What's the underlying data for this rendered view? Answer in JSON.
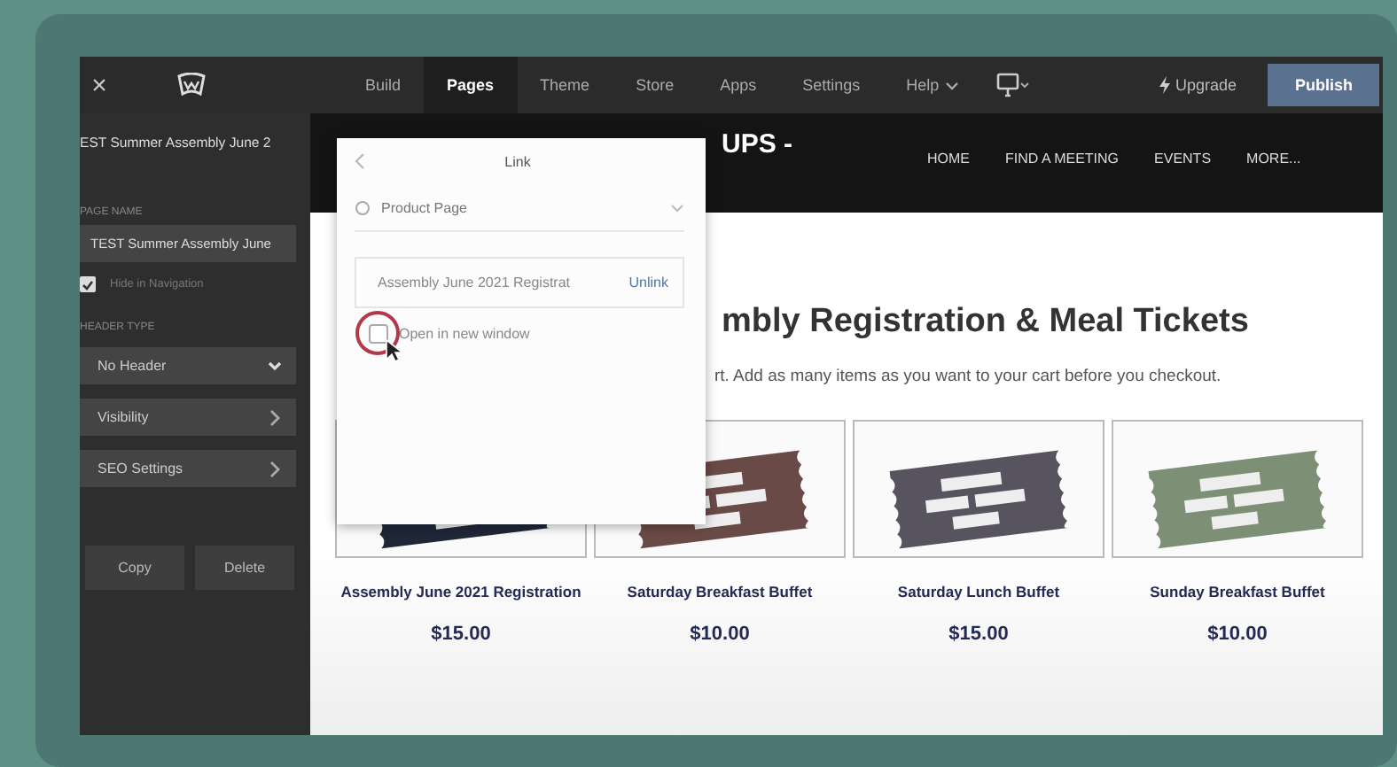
{
  "topbar": {
    "close": "×",
    "upgrade": "Upgrade",
    "publish": "Publish",
    "tabs": [
      {
        "label": "Build",
        "selected": false,
        "kind": "plain"
      },
      {
        "label": "Pages",
        "selected": true,
        "kind": "plain"
      },
      {
        "label": "Theme",
        "selected": false,
        "kind": "plain"
      },
      {
        "label": "Store",
        "selected": false,
        "kind": "plain"
      },
      {
        "label": "Apps",
        "selected": false,
        "kind": "plain"
      },
      {
        "label": "Settings",
        "selected": false,
        "kind": "plain"
      },
      {
        "label": "Help",
        "selected": false,
        "kind": "menu"
      }
    ]
  },
  "sidebar": {
    "title": "EST Summer Assembly June 2",
    "page_name_label": "PAGE NAME",
    "page_name": "TEST Summer Assembly June",
    "hide_in_navigation": {
      "label": "Hide in Navigation",
      "checked": true
    },
    "header_type_label": "HEADER TYPE",
    "header_type": "No Header",
    "sections": [
      "Visibility",
      "SEO Settings"
    ],
    "buttons": [
      "Copy",
      "Delete"
    ]
  },
  "link_popup": {
    "title": "Link",
    "link_type": "Product Page",
    "linked_item": "Assembly June 2021 Registrat",
    "unlink": "Unlink",
    "open_in_new_window": {
      "label": "Open in new window",
      "checked": false
    }
  },
  "site": {
    "header_title": [
      "UPS -"
    ],
    "nav": [
      "HOME",
      "FIND A MEETING",
      "EVENTS",
      "MORE..."
    ],
    "heading": "mbly Registration & Meal Tickets",
    "intro": "rt.  Add as many items as you want to your cart before you checkout.",
    "products": [
      {
        "name": "Assembly June 2021 Registration",
        "price": "$15.00",
        "color": "#1f2738"
      },
      {
        "name": "Saturday Breakfast Buffet",
        "price": "$10.00",
        "color": "#6a4a46"
      },
      {
        "name": "Saturday Lunch Buffet",
        "price": "$15.00",
        "color": "#57535f"
      },
      {
        "name": "Sunday Breakfast Buffet",
        "price": "$10.00",
        "color": "#7d8f74"
      }
    ]
  }
}
